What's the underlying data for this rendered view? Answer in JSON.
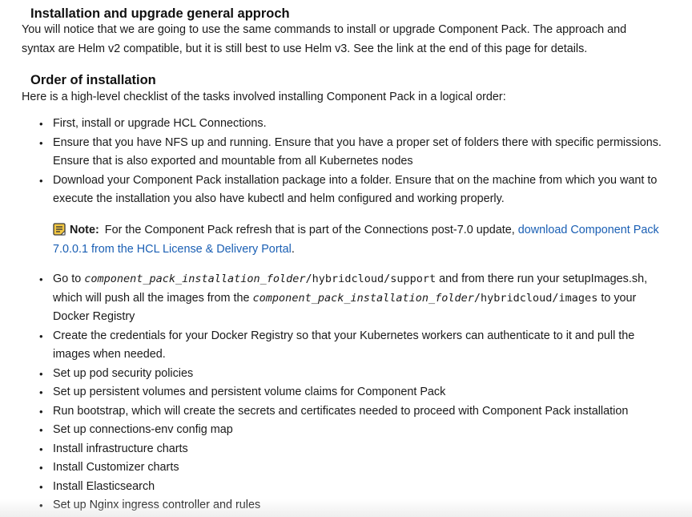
{
  "section1": {
    "heading": "Installation and upgrade general approch",
    "paragraph": "You will notice that we are going to use the same commands to install or upgrade Component Pack. The approach and syntax are Helm v2 compatible, but it is still best to use Helm v3. See the link at the end of this page for details."
  },
  "section2": {
    "heading": "Order of installation",
    "intro": "Here is a high-level checklist of the tasks involved installing Component Pack in a logical order:",
    "bullet": "•",
    "items_a": [
      "First, install or upgrade HCL Connections.",
      "Ensure that you have NFS up and running. Ensure that you have a proper set of folders there with specific permissions. Ensure that is also exported and mountable from all Kubernetes nodes",
      "Download your Component Pack installation package into a folder. Ensure that on the machine from which you want to execute the installation you also have kubectl and helm configured and working properly."
    ],
    "note": {
      "icon": "note-icon",
      "label": "Note:",
      "text": "For the Component Pack refresh that is part of the Connections post-7.0 update,",
      "link_text": "download Component Pack 7.0.0.1 from the HCL License & Delivery Portal",
      "end": "."
    },
    "item_go": {
      "t1": "Go to ",
      "c1": "component_pack_installation_folder",
      "c2": "/hybridcloud/support",
      "t2": " and from there run your setupImages.sh, which will push all the images from the ",
      "c3": "component_pack_installation_folder",
      "c4": "/hybridcloud/images",
      "t3": " to your Docker Registry"
    },
    "items_b": [
      "Create the credentials for your Docker Registry so that your Kubernetes workers can authenticate to it and pull the images when needed.",
      "Set up pod security policies",
      "Set up persistent volumes and persistent volume claims for Component Pack",
      "Run bootstrap, which will create the secrets and certificates needed to proceed with Component Pack installation",
      "Set up connections-env config map",
      "Install infrastructure charts",
      "Install Customizer charts",
      "Install Elasticsearch",
      "Set up Nginx ingress controller and rules"
    ]
  },
  "colors": {
    "text": "#1a1a1a",
    "link": "#1a5fb4",
    "note_icon": "#f2c744"
  }
}
